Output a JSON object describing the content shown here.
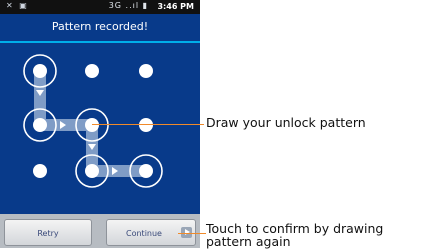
{
  "status_bar": {
    "left_icons": "✕ ▣",
    "signal_icons": "3G ..ıl ▮",
    "time": "3:46 PM"
  },
  "header": {
    "title": "Pattern recorded!"
  },
  "buttons": {
    "retry": "Retry",
    "continue": "Continue"
  },
  "callouts": {
    "draw": "Draw your unlock pattern",
    "confirm_line1": "Touch to confirm by drawing",
    "confirm_line2": "pattern again"
  },
  "colors": {
    "background": "#083a8a",
    "accent_line": "#00aeea",
    "callout": "#f08a2a",
    "path": "#7f9cc6"
  },
  "pattern": {
    "grid_size": 3,
    "sequence": [
      0,
      3,
      4,
      7,
      8
    ]
  }
}
